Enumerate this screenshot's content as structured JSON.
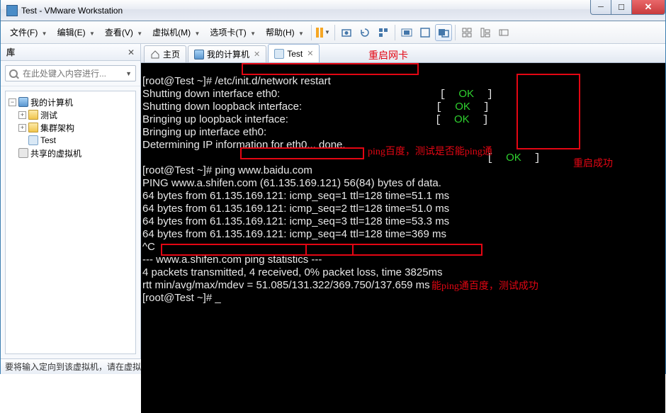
{
  "window": {
    "title": "Test - VMware Workstation"
  },
  "menu": {
    "file": "文件(F)",
    "edit": "编辑(E)",
    "view": "查看(V)",
    "vm": "虚拟机(M)",
    "tabs": "选项卡(T)",
    "help": "帮助(H)"
  },
  "sidebar": {
    "title": "库",
    "search_placeholder": "在此处键入内容进行...",
    "nodes": {
      "root": "我的计算机",
      "n1": "测试",
      "n2": "集群架构",
      "n3": "Test",
      "shared": "共享的虚拟机"
    }
  },
  "tabs": {
    "home": "主页",
    "mypc": "我的计算机",
    "test": "Test"
  },
  "annotations": {
    "a1": "重启网卡",
    "a2": "ping百度，测试是否能ping通",
    "a3": "重启成功",
    "a4": "能ping通百度，测试成功"
  },
  "terminal": {
    "l1": "[root@Test ~]# /etc/init.d/network restart",
    "l2": "Shutting down interface eth0:",
    "l3": "Shutting down loopback interface:",
    "l4": "Bringing up loopback interface:",
    "l5": "Bringing up interface eth0:",
    "l6": "Determining IP information for eth0... done.",
    "l7": "",
    "l8": "[root@Test ~]# ping www.baidu.com",
    "l9": "PING www.a.shifen.com (61.135.169.121) 56(84) bytes of data.",
    "l10": "64 bytes from 61.135.169.121: icmp_seq=1 ttl=128 time=51.1 ms",
    "l11": "64 bytes from 61.135.169.121: icmp_seq=2 ttl=128 time=51.0 ms",
    "l12": "64 bytes from 61.135.169.121: icmp_seq=3 ttl=128 time=53.3 ms",
    "l13": "64 bytes from 61.135.169.121: icmp_seq=4 ttl=128 time=369 ms",
    "l14": "^C",
    "l15": "--- www.a.shifen.com ping statistics ---",
    "l16": "4 packets transmitted, 4 received, 0% packet loss, time 3825ms",
    "l17": "rtt min/avg/max/mdev = 51.085/131.322/369.750/137.659 ms",
    "l18": "[root@Test ~]# _",
    "ok": "OK"
  },
  "status": {
    "text": "要将输入定向到该虚拟机，请在虚拟机内部单击或按 Ctrl+G。"
  }
}
